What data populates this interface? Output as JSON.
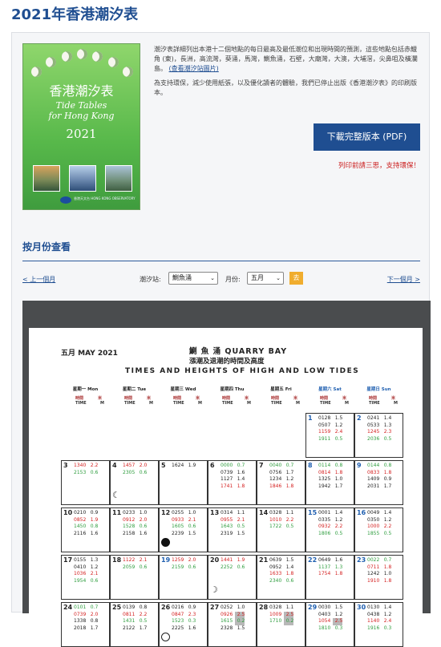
{
  "page": {
    "title": "2021年香港潮汐表"
  },
  "cover": {
    "title_cn": "香港潮汐表",
    "title_en_1": "Tide Tables",
    "title_en_2": "for Hong Kong",
    "year": "2021",
    "logo_text": "香港天文台 HONG KONG OBSERVATORY"
  },
  "intro": {
    "text1": "潮汐表詳細列出本港十二個地點的每日最高及最低潮位和出現時間的預測，這些地點包括赤鱲角 (東)，長洲，高流灣，葵涌，馬灣，鰂魚涌，石壁，大廟灣，大澳，大埔滘，尖鼻咀及橫瀾島。",
    "link": "(查看潮汐站圖片)",
    "text2": "為支持環保，減少使用紙張，以及優化讀者的體驗，我們已停止出版《香港潮汐表》的印刷版本。"
  },
  "download": {
    "label": "下載完整版本 (PDF)",
    "note": "列印前請三思，支持環保！"
  },
  "monthly": {
    "title": "按月份查看",
    "prev": "< 上一個月",
    "next": "下一個月 >",
    "station_label": "潮汐站:",
    "station_value": "鰂魚涌",
    "month_label": "月份:",
    "month_value": "五月",
    "go": "去"
  },
  "sheet": {
    "month": "五月 MAY 2021",
    "station": "鰂 魚 涌   QUARRY  BAY",
    "title_cn": "漲潮及退潮的時間及高度",
    "title_en": "TIMES AND HEIGHTS OF HIGH AND LOW TIDES",
    "colors": {
      "high": "#d42020",
      "low": "#2e9d3e"
    },
    "days": [
      "星期一 Mon",
      "星期二 Tue",
      "星期三 Wed",
      "星期四 Thu",
      "星期五 Fri",
      "星期六 Sat",
      "星期日 Sun"
    ],
    "time_label": "時間",
    "time_en": "TIME",
    "m_label": "米",
    "m_en": "M",
    "weeks": [
      [
        null,
        null,
        null,
        null,
        null,
        {
          "d": "1",
          "t": [
            [
              "0128",
              "1.5",
              "k"
            ],
            [
              "0507",
              "1.2",
              "k"
            ],
            [
              "1159",
              "2.4",
              "r"
            ],
            [
              "1911",
              "0.5",
              "g"
            ]
          ]
        },
        {
          "d": "2",
          "t": [
            [
              "0241",
              "1.4",
              "k"
            ],
            [
              "0533",
              "1.3",
              "k"
            ],
            [
              "1245",
              "2.3",
              "r"
            ],
            [
              "2036",
              "0.5",
              "g"
            ]
          ]
        }
      ],
      [
        {
          "d": "3",
          "t": [
            [
              "1340",
              "2.2",
              "r"
            ],
            [
              "2153",
              "0.6",
              "g"
            ]
          ]
        },
        {
          "d": "4",
          "moon": "q",
          "t": [
            [
              "1457",
              "2.0",
              "r"
            ],
            [
              "2305",
              "0.6",
              "g"
            ]
          ]
        },
        {
          "d": "5",
          "t": [
            [
              "1624",
              "1.9",
              "k"
            ]
          ]
        },
        {
          "d": "6",
          "t": [
            [
              "0000",
              "0.7",
              "g"
            ],
            [
              "0739",
              "1.6",
              "k"
            ],
            [
              "1127",
              "1.4",
              "k"
            ],
            [
              "1741",
              "1.8",
              "r"
            ]
          ]
        },
        {
          "d": "7",
          "t": [
            [
              "0040",
              "0.7",
              "g"
            ],
            [
              "0756",
              "1.7",
              "k"
            ],
            [
              "1234",
              "1.2",
              "k"
            ],
            [
              "1846",
              "1.8",
              "r"
            ]
          ]
        },
        {
          "d": "8",
          "t": [
            [
              "0114",
              "0.8",
              "g"
            ],
            [
              "0814",
              "1.8",
              "r"
            ],
            [
              "1325",
              "1.0",
              "k"
            ],
            [
              "1942",
              "1.7",
              "k"
            ]
          ]
        },
        {
          "d": "9",
          "t": [
            [
              "0144",
              "0.8",
              "g"
            ],
            [
              "0833",
              "1.8",
              "r"
            ],
            [
              "1409",
              "0.9",
              "k"
            ],
            [
              "2031",
              "1.7",
              "k"
            ]
          ]
        }
      ],
      [
        {
          "d": "10",
          "t": [
            [
              "0210",
              "0.9",
              "k"
            ],
            [
              "0852",
              "1.9",
              "r"
            ],
            [
              "1450",
              "0.8",
              "g"
            ],
            [
              "2116",
              "1.6",
              "k"
            ]
          ]
        },
        {
          "d": "11",
          "t": [
            [
              "0233",
              "1.0",
              "k"
            ],
            [
              "0912",
              "2.0",
              "r"
            ],
            [
              "1528",
              "0.6",
              "g"
            ],
            [
              "2158",
              "1.6",
              "k"
            ]
          ]
        },
        {
          "d": "12",
          "moon": "new",
          "t": [
            [
              "0255",
              "1.0",
              "k"
            ],
            [
              "0933",
              "2.1",
              "r"
            ],
            [
              "1605",
              "0.6",
              "g"
            ],
            [
              "2239",
              "1.5",
              "k"
            ]
          ]
        },
        {
          "d": "13",
          "t": [
            [
              "0314",
              "1.1",
              "k"
            ],
            [
              "0955",
              "2.1",
              "r"
            ],
            [
              "1643",
              "0.5",
              "g"
            ],
            [
              "2319",
              "1.5",
              "k"
            ]
          ]
        },
        {
          "d": "14",
          "t": [
            [
              "0328",
              "1.1",
              "k"
            ],
            [
              "1010",
              "2.2",
              "r"
            ],
            [
              "1722",
              "0.5",
              "g"
            ]
          ]
        },
        {
          "d": "15",
          "t": [
            [
              "0001",
              "1.4",
              "k"
            ],
            [
              "0335",
              "1.2",
              "k"
            ],
            [
              "0932",
              "2.2",
              "r"
            ],
            [
              "1806",
              "0.5",
              "g"
            ]
          ]
        },
        {
          "d": "16",
          "t": [
            [
              "0049",
              "1.4",
              "k"
            ],
            [
              "0350",
              "1.2",
              "k"
            ],
            [
              "1000",
              "2.2",
              "r"
            ],
            [
              "1855",
              "0.5",
              "g"
            ]
          ]
        }
      ],
      [
        {
          "d": "17",
          "t": [
            [
              "0155",
              "1.3",
              "k"
            ],
            [
              "0410",
              "1.2",
              "k"
            ],
            [
              "1036",
              "2.1",
              "r"
            ],
            [
              "1954",
              "0.6",
              "g"
            ]
          ]
        },
        {
          "d": "18",
          "t": [
            [
              "1122",
              "2.1",
              "r"
            ],
            [
              "2059",
              "0.6",
              "g"
            ]
          ]
        },
        {
          "d": "19",
          "blue": true,
          "t": [
            [
              "1259",
              "2.0",
              "r"
            ],
            [
              "2159",
              "0.6",
              "g"
            ]
          ]
        },
        {
          "d": "20",
          "moon": "q2",
          "t": [
            [
              "1441",
              "1.9",
              "r"
            ],
            [
              "2252",
              "0.6",
              "g"
            ]
          ]
        },
        {
          "d": "21",
          "t": [
            [
              "0639",
              "1.5",
              "k"
            ],
            [
              "0952",
              "1.4",
              "k"
            ],
            [
              "1633",
              "1.8",
              "r"
            ],
            [
              "2340",
              "0.6",
              "g"
            ]
          ]
        },
        {
          "d": "22",
          "t": [
            [
              "0649",
              "1.6",
              "k"
            ],
            [
              "1137",
              "1.3",
              "g"
            ],
            [
              "1754",
              "1.8",
              "r"
            ]
          ]
        },
        {
          "d": "23",
          "t": [
            [
              "0022",
              "0.7",
              "g"
            ],
            [
              "0711",
              "1.8",
              "r"
            ],
            [
              "1242",
              "1.0",
              "k"
            ],
            [
              "1910",
              "1.8",
              "r"
            ]
          ]
        }
      ],
      [
        {
          "d": "24",
          "t": [
            [
              "0101",
              "0.7",
              "g"
            ],
            [
              "0739",
              "2.0",
              "r"
            ],
            [
              "1338",
              "0.8",
              "k"
            ],
            [
              "2018",
              "1.7",
              "k"
            ]
          ]
        },
        {
          "d": "25",
          "t": [
            [
              "0139",
              "0.8",
              "k"
            ],
            [
              "0811",
              "2.2",
              "r"
            ],
            [
              "1431",
              "0.5",
              "g"
            ],
            [
              "2122",
              "1.7",
              "k"
            ]
          ]
        },
        {
          "d": "26",
          "moon": "full",
          "t": [
            [
              "0216",
              "0.9",
              "k"
            ],
            [
              "0847",
              "2.3",
              "r"
            ],
            [
              "1523",
              "0.3",
              "g"
            ],
            [
              "2225",
              "1.6",
              "k"
            ]
          ]
        },
        {
          "d": "27",
          "t": [
            [
              "0252",
              "1.0",
              "k"
            ],
            [
              "0926",
              "2.5",
              "r",
              "hl"
            ],
            [
              "1615",
              "0.2",
              "g",
              "hl"
            ],
            [
              "2328",
              "1.5",
              "k"
            ]
          ]
        },
        {
          "d": "28",
          "t": [
            [
              "0328",
              "1.1",
              "k"
            ],
            [
              "1009",
              "2.5",
              "r",
              "hl"
            ],
            [
              "1710",
              "0.2",
              "g",
              "hl"
            ]
          ]
        },
        {
          "d": "29",
          "t": [
            [
              "0030",
              "1.5",
              "k"
            ],
            [
              "0403",
              "1.2",
              "k"
            ],
            [
              "1054",
              "2.5",
              "r",
              "hl"
            ],
            [
              "1810",
              "0.3",
              "g"
            ]
          ]
        },
        {
          "d": "30",
          "t": [
            [
              "0130",
              "1.4",
              "k"
            ],
            [
              "0438",
              "1.2",
              "k"
            ],
            [
              "1140",
              "2.4",
              "r"
            ],
            [
              "1916",
              "0.3",
              "g"
            ]
          ]
        }
      ]
    ]
  }
}
